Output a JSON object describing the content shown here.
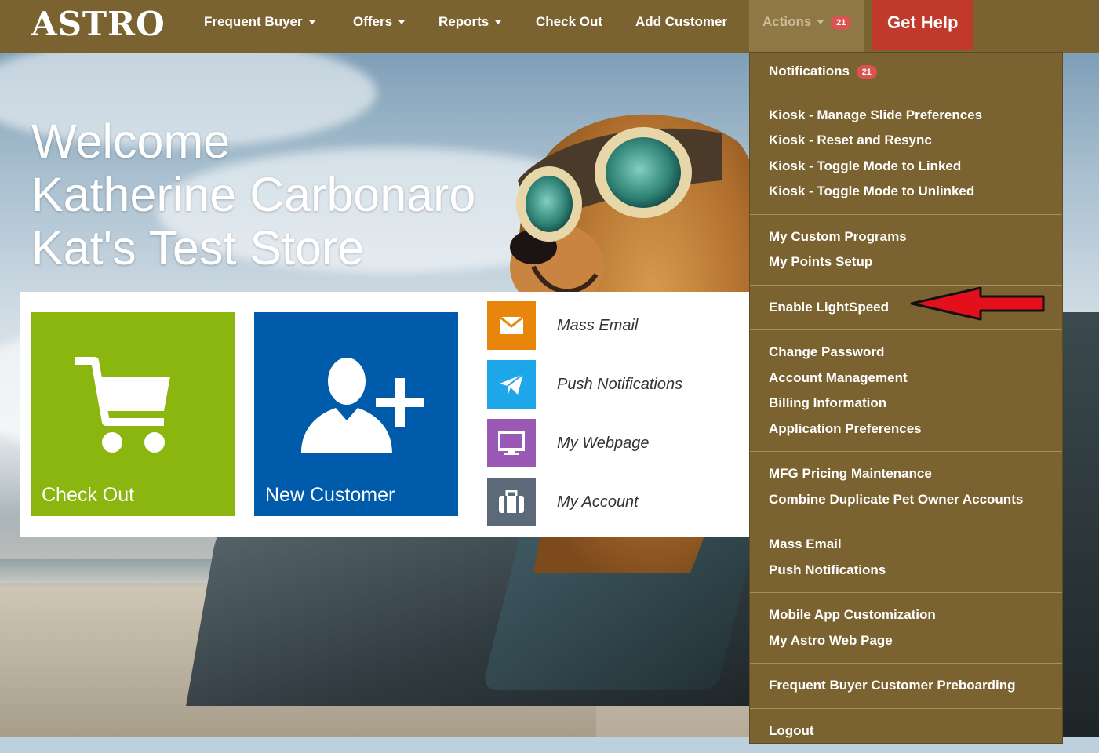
{
  "navbar": {
    "logo": "ASTRO",
    "frequent_buyer": "Frequent Buyer",
    "offers": "Offers",
    "reports": "Reports",
    "check_out": "Check Out",
    "add_customer": "Add Customer",
    "actions": "Actions",
    "actions_badge": "21",
    "get_help": "Get Help"
  },
  "welcome": {
    "line1": "Welcome",
    "line2": "Katherine Carbonaro",
    "line3": "Kat's Test Store"
  },
  "tiles": {
    "check_out": "Check Out",
    "new_customer": "New Customer"
  },
  "quick_links": [
    {
      "label": "Mass Email",
      "icon": "envelope-icon",
      "color": "#e8860c"
    },
    {
      "label": "Push Notifications",
      "icon": "paper-plane-icon",
      "color": "#1ea7e8"
    },
    {
      "label": "My Webpage",
      "icon": "monitor-icon",
      "color": "#9b59b6"
    },
    {
      "label": "My Account",
      "icon": "briefcase-icon",
      "color": "#5b6978"
    }
  ],
  "actions_menu": {
    "notifications": "Notifications",
    "notifications_badge": "21",
    "kiosk_slides": "Kiosk - Manage Slide Preferences",
    "kiosk_reset": "Kiosk - Reset and Resync",
    "kiosk_linked": "Kiosk - Toggle Mode to Linked",
    "kiosk_unlinked": "Kiosk - Toggle Mode to Unlinked",
    "custom_programs": "My Custom Programs",
    "points_setup": "My Points Setup",
    "enable_lightspeed": "Enable LightSpeed",
    "change_password": "Change Password",
    "account_management": "Account Management",
    "billing_information": "Billing Information",
    "application_preferences": "Application Preferences",
    "mfg_pricing": "MFG Pricing Maintenance",
    "combine_duplicates": "Combine Duplicate Pet Owner Accounts",
    "mass_email": "Mass Email",
    "push_notifications": "Push Notifications",
    "mobile_app": "Mobile App Customization",
    "astro_web_page": "My Astro Web Page",
    "preboarding": "Frequent Buyer Customer Preboarding",
    "logout": "Logout"
  },
  "colors": {
    "navbar": "#7b6331",
    "get_help": "#c0392b",
    "badge": "#d9534f",
    "check_out_tile": "#8bb60f",
    "new_customer_tile": "#005bab",
    "annotation_arrow": "#e3101b"
  }
}
